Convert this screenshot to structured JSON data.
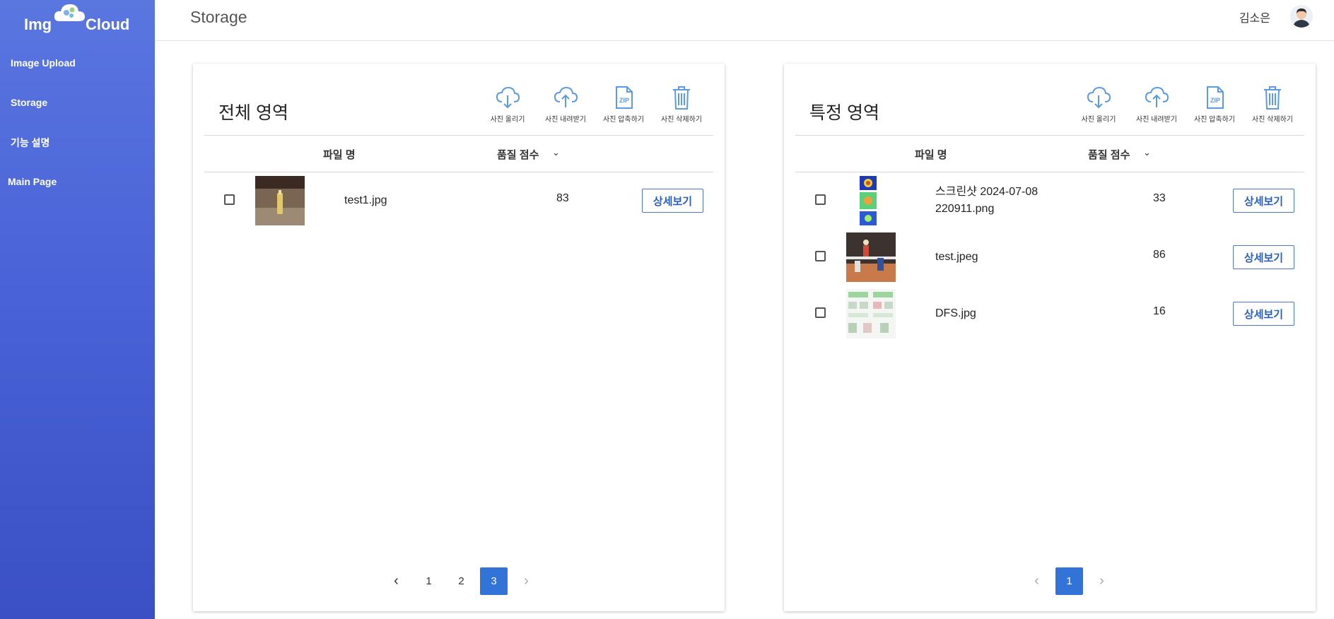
{
  "app": {
    "logo_left": "Img",
    "logo_right": "Cloud"
  },
  "sidebar": {
    "items": [
      {
        "label": "Image Upload"
      },
      {
        "label": "Storage"
      },
      {
        "label": "기능 설명"
      },
      {
        "label": "Main Page"
      }
    ]
  },
  "header": {
    "title": "Storage",
    "user_name": "김소은"
  },
  "toolbar_labels": {
    "upload": "사진 올리기",
    "download": "사진 내려받기",
    "zip": "사진 압축하기",
    "delete": "사진 삭제하기",
    "zip_text": "ZIP"
  },
  "columns": {
    "file_name": "파일 명",
    "quality": "품질 점수",
    "sort_icon": "⌄"
  },
  "detail_label": "상세보기",
  "panels": {
    "all": {
      "title": "전체 영역",
      "rows": [
        {
          "file": "test1.jpg",
          "score": "83"
        }
      ],
      "pagination": {
        "prev": "‹",
        "next": "›",
        "pages": [
          "1",
          "2",
          "3"
        ],
        "active": "3"
      }
    },
    "specific": {
      "title": "특정 영역",
      "rows": [
        {
          "file_line1": "스크린샷 2024-07-08",
          "file_line2": "220911.png",
          "score": "33"
        },
        {
          "file": "test.jpeg",
          "score": "86"
        },
        {
          "file": "DFS.jpg",
          "score": "16"
        }
      ],
      "pagination": {
        "prev": "‹",
        "next": "›",
        "pages": [
          "1"
        ],
        "active": "1"
      }
    }
  },
  "colors": {
    "accent": "#3273d8",
    "sidebar_top": "#5a76df",
    "sidebar_bottom": "#3a50c4",
    "icon": "#5b9ae6"
  },
  "icons": [
    "cloud-download-icon",
    "cloud-upload-icon",
    "zip-file-icon",
    "trash-icon",
    "chevron-down-icon",
    "chevron-left-icon",
    "chevron-right-icon"
  ]
}
